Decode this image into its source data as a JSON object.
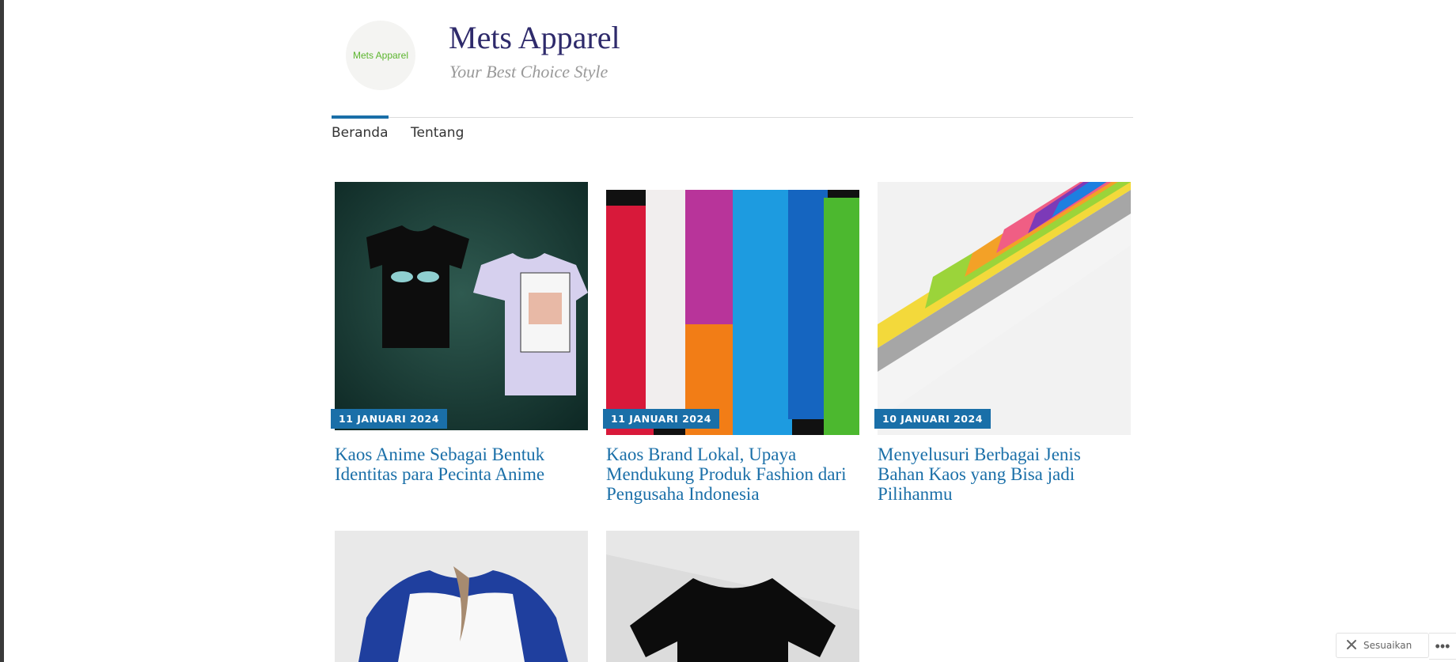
{
  "site": {
    "logo_text": "Mets Apparel",
    "title": "Mets Apparel",
    "tagline": "Your Best Choice Style"
  },
  "nav": {
    "items": [
      {
        "label": "Beranda",
        "active": true
      },
      {
        "label": "Tentang",
        "active": false
      }
    ]
  },
  "posts": [
    {
      "date": "11 JANUARI 2024",
      "title": "Kaos Anime Sebagai Bentuk Identitas para Pecinta Anime"
    },
    {
      "date": "11 JANUARI 2024",
      "title": "Kaos Brand Lokal, Upaya Mendukung Produk Fashion dari Pengusaha Indonesia"
    },
    {
      "date": "10 JANUARI 2024",
      "title": "Menyelusuri Berbagai Jenis Bahan Kaos yang Bisa jadi Pilihanmu"
    },
    {
      "date": "",
      "title": ""
    },
    {
      "date": "",
      "title": ""
    }
  ],
  "footer": {
    "customize_label": "Sesuaikan",
    "customize_icon": "tools-icon",
    "more_icon": "ellipsis-icon"
  },
  "colors": {
    "accent": "#1a6fa8",
    "site_title": "#2e2a6b",
    "logo_text": "#5bb52e"
  }
}
